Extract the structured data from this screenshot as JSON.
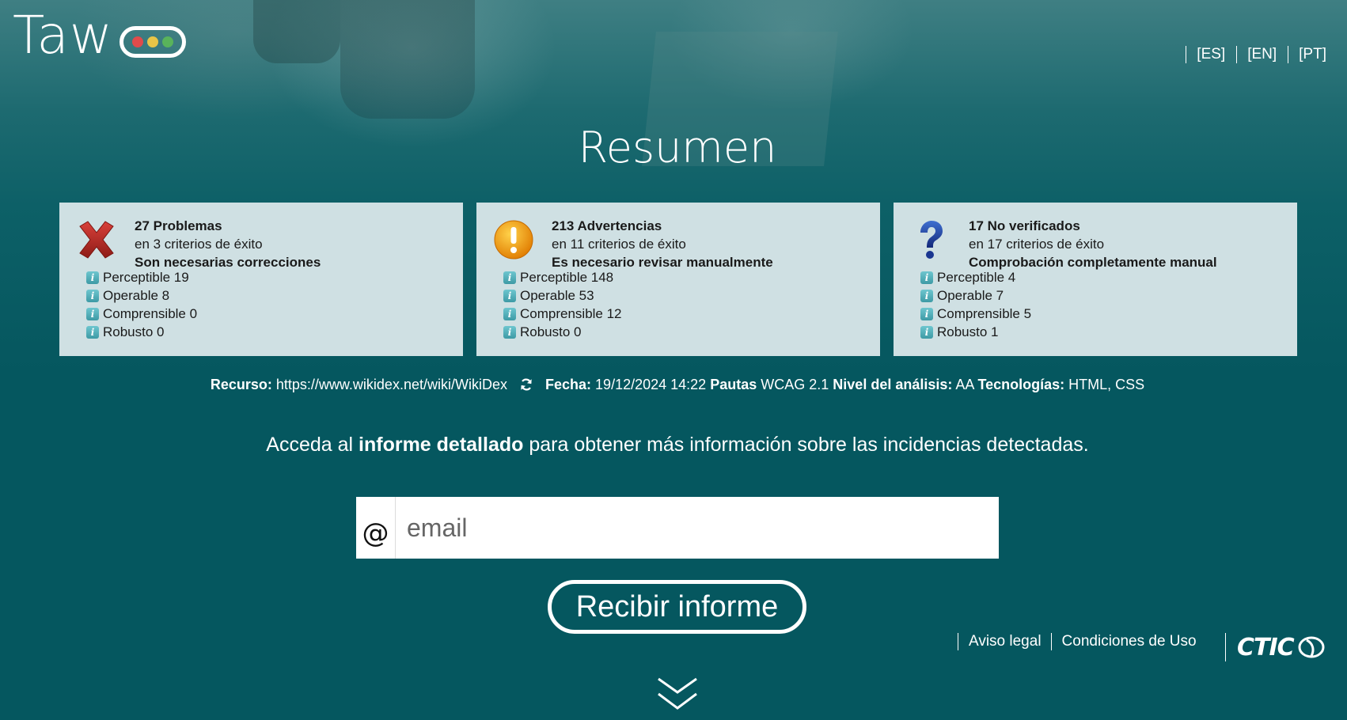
{
  "brand": {
    "logo_text": "Taw"
  },
  "languages": [
    "[ES]",
    "[EN]",
    "[PT]"
  ],
  "page_title": "Resumen",
  "cards": [
    {
      "icon": "error-x-icon",
      "count_line": "27 Problemas",
      "criteria_line": "en 3 criterios de éxito",
      "status_line": "Son necesarias correcciones",
      "items": [
        "Perceptible 19",
        "Operable 8",
        "Comprensible 0",
        "Robusto 0"
      ]
    },
    {
      "icon": "warning-exclamation-icon",
      "count_line": "213 Advertencias",
      "criteria_line": "en 11 criterios de éxito",
      "status_line": "Es necesario revisar manualmente",
      "items": [
        "Perceptible 148",
        "Operable 53",
        "Comprensible 12",
        "Robusto 0"
      ]
    },
    {
      "icon": "question-mark-icon",
      "count_line": "17 No verificados",
      "criteria_line": "en 17 criterios de éxito",
      "status_line": "Comprobación completamente manual",
      "items": [
        "Perceptible 4",
        "Operable 7",
        "Comprensible 5",
        "Robusto 1"
      ]
    }
  ],
  "meta": {
    "resource_label": "Recurso:",
    "resource_value": "https://www.wikidex.net/wiki/WikiDex",
    "date_label": "Fecha:",
    "date_value": "19/12/2024 14:22",
    "guidelines_label": "Pautas",
    "guidelines_value": "WCAG 2.1",
    "level_label": "Nivel del análisis:",
    "level_value": "AA",
    "tech_label": "Tecnologías:",
    "tech_value": "HTML, CSS"
  },
  "detailed": {
    "prefix": "Acceda al",
    "bold": "informe detallado",
    "suffix": "para obtener más información sobre las incidencias detectadas."
  },
  "email": {
    "at_symbol": "@",
    "placeholder": "email",
    "value": ""
  },
  "submit_label": "Recibir informe",
  "footer": {
    "links": [
      "Aviso legal",
      "Condiciones de Uso"
    ],
    "ctic_logo": "CTIC"
  },
  "colors": {
    "background": "#05575f",
    "card_bg": "#cfe0e3",
    "error": "#b3261e",
    "warning": "#f39c12",
    "question": "#1f3f8f"
  }
}
